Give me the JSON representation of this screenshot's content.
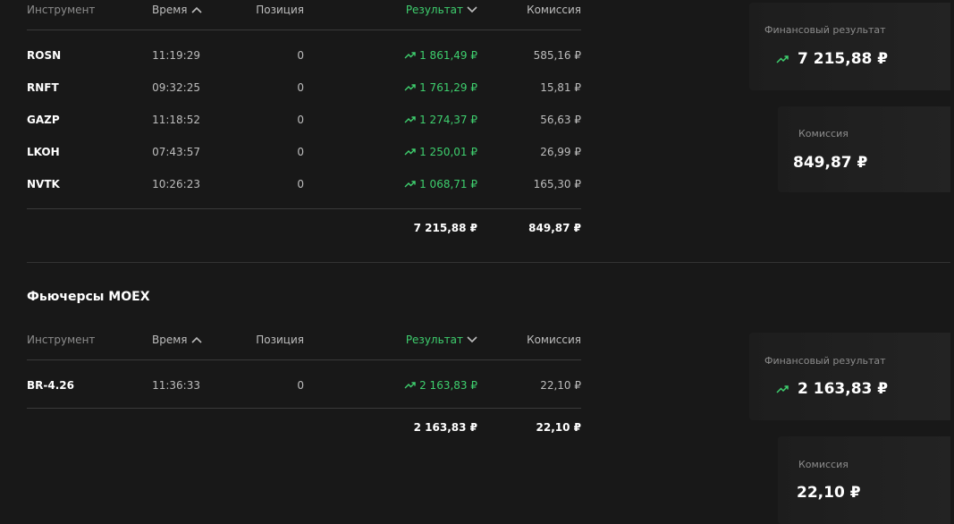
{
  "headers": {
    "instrument": "Инструмент",
    "time": "Время",
    "position": "Позиция",
    "result": "Результат",
    "commission": "Комиссия"
  },
  "stocks": {
    "rows": [
      {
        "instrument": "ROSN",
        "time": "11:19:29",
        "position": "0",
        "result": "1 861,49 ₽",
        "commission": "585,16 ₽"
      },
      {
        "instrument": "RNFT",
        "time": "09:32:25",
        "position": "0",
        "result": "1 761,29 ₽",
        "commission": "15,81 ₽"
      },
      {
        "instrument": "GAZP",
        "time": "11:18:52",
        "position": "0",
        "result": "1 274,37 ₽",
        "commission": "56,63 ₽"
      },
      {
        "instrument": "LKOH",
        "time": "07:43:57",
        "position": "0",
        "result": "1 250,01 ₽",
        "commission": "26,99 ₽"
      },
      {
        "instrument": "NVTK",
        "time": "10:26:23",
        "position": "0",
        "result": "1 068,71 ₽",
        "commission": "165,30 ₽"
      }
    ],
    "total_result": "7 215,88 ₽",
    "total_commission": "849,87 ₽",
    "card_result_label": "Финансовый результат",
    "card_result_value": "7 215,88 ₽",
    "card_commission_label": "Комиссия",
    "card_commission_value": "849,87 ₽"
  },
  "futures": {
    "title": "Фьючерсы MOEX",
    "rows": [
      {
        "instrument": "BR-4.26",
        "time": "11:36:33",
        "position": "0",
        "result": "2 163,83 ₽",
        "commission": "22,10 ₽"
      }
    ],
    "total_result": "2 163,83 ₽",
    "total_commission": "22,10 ₽",
    "card_result_label": "Финансовый результат",
    "card_result_value": "2 163,83 ₽",
    "card_commission_label": "Комиссия",
    "card_commission_value": "22,10 ₽"
  },
  "colors": {
    "positive": "#3ecf6e",
    "background": "#181818"
  },
  "icons": {
    "trend": "trend-up-icon",
    "sort_asc": "chevron-up-icon",
    "sort_desc": "chevron-down-icon"
  }
}
